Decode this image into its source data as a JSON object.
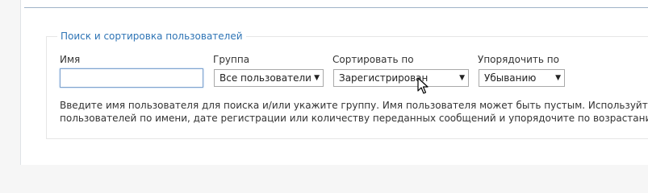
{
  "search_form": {
    "legend": "Поиск и сортировка пользователей",
    "name_label": "Имя",
    "name_value": "",
    "group_label": "Группа",
    "group_value": "Все пользователи",
    "sort_by_label": "Сортировать по",
    "sort_by_value": "Зарегистрирован",
    "order_label": "Упорядочить по",
    "order_value": "Убыванию",
    "help_line1": "Введите имя пользователя для поиска и/или укажите группу. Имя пользователя может быть пустым. Используйте * в кач",
    "help_line2": "пользователей по имени, дате регистрации или количеству переданных сообщений и упорядочите по возрастанию/убыва"
  },
  "icons": {
    "dropdown_arrow": "triangle-down",
    "pointer": "mouse-pointer-icon"
  }
}
